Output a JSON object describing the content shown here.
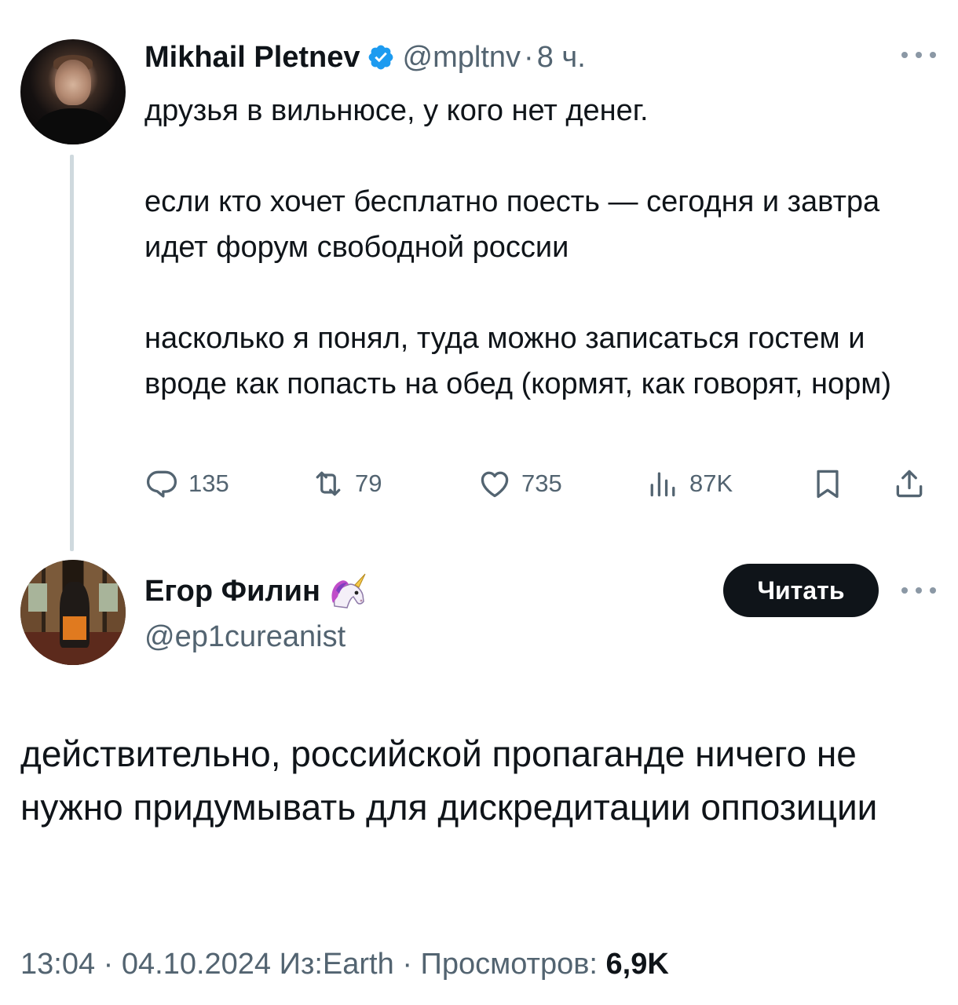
{
  "parent_tweet": {
    "author_name": "Mikhail Pletnev",
    "verified": true,
    "handle": "@mpltnv",
    "separator": "·",
    "time": "8 ч.",
    "paragraphs": [
      "друзья в вильнюсе, у кого нет денег.",
      "если кто хочет бесплатно поесть — сегодня и завтра идет форум свободной россии",
      "насколько я понял, туда можно записаться гостем и вроде как попасть на обед (кормят, как говорят, норм)"
    ],
    "actions": {
      "replies": "135",
      "retweets": "79",
      "likes": "735",
      "views": "87K"
    }
  },
  "main_tweet": {
    "author_name": "Егор Филин",
    "name_emoji": "unicorn-icon",
    "handle": "@ep1cureanist",
    "follow_label": "Читать",
    "text": "действительно, российской пропаганде ничего не нужно придумывать для дискредитации оппозиции",
    "time": "13:04",
    "separator": "·",
    "date": "04.10.2024",
    "source": "Из:Earth",
    "views_label": "Просмотров:",
    "views_count": "6,9K"
  },
  "colors": {
    "text_primary": "#0f1419",
    "text_secondary": "#536471",
    "verified_blue": "#1d9bf0",
    "thread_line": "#cfd9de",
    "button_bg": "#0f1419"
  }
}
